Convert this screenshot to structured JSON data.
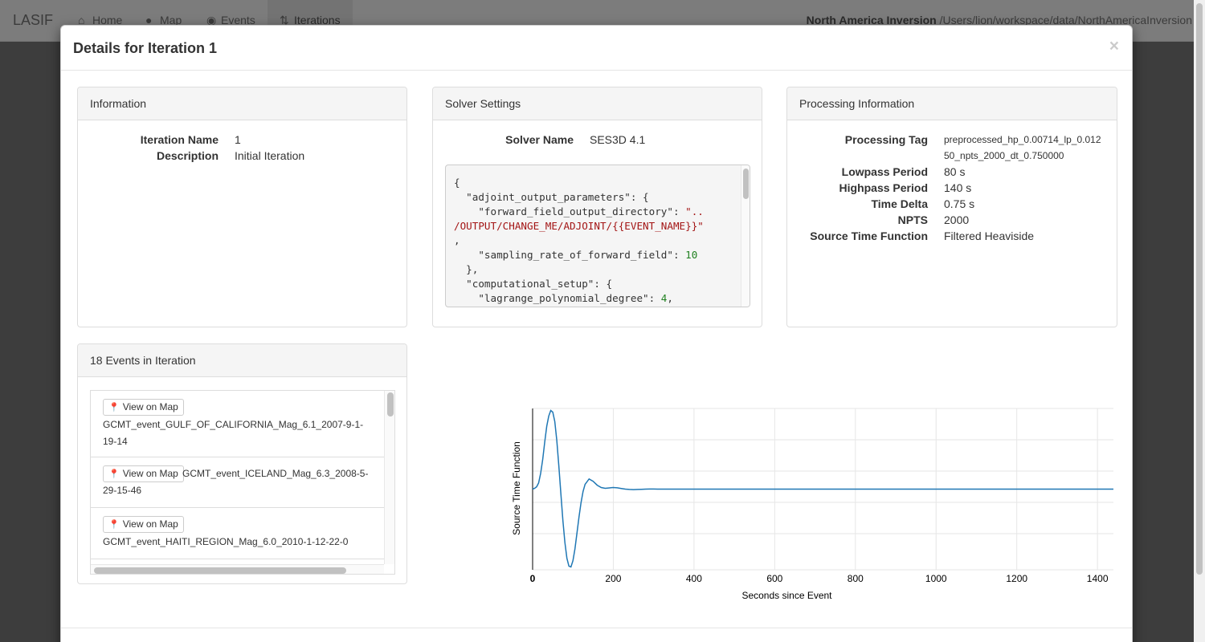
{
  "navbar": {
    "brand": "LASIF",
    "items": [
      {
        "label": "Home",
        "icon": "home-icon"
      },
      {
        "label": "Map",
        "icon": "globe-icon"
      },
      {
        "label": "Events",
        "icon": "record-icon"
      },
      {
        "label": "Iterations",
        "icon": "sort-icon"
      }
    ],
    "project_name": "North America Inversion",
    "project_path": "/Users/lion/workspace/data/NorthAmericaInversion"
  },
  "modal": {
    "title": "Details for Iteration 1",
    "close": "×"
  },
  "information": {
    "heading": "Information",
    "rows": [
      {
        "label": "Iteration Name",
        "value": "1"
      },
      {
        "label": "Description",
        "value": "Initial Iteration"
      }
    ]
  },
  "solver": {
    "heading": "Solver Settings",
    "name_label": "Solver Name",
    "name_value": "SES3D 4.1",
    "code_lines": [
      [
        {
          "t": "p",
          "v": "{"
        }
      ],
      [
        {
          "t": "p",
          "v": "  \"adjoint_output_parameters\": {"
        }
      ],
      [
        {
          "t": "p",
          "v": "    \"forward_field_output_directory\": "
        },
        {
          "t": "s",
          "v": "\".."
        }
      ],
      [
        {
          "t": "s",
          "v": "/OUTPUT/CHANGE_ME/ADJOINT/{{EVENT_NAME}}\""
        }
      ],
      [
        {
          "t": "p",
          "v": ","
        }
      ],
      [
        {
          "t": "p",
          "v": "    \"sampling_rate_of_forward_field\": "
        },
        {
          "t": "n",
          "v": "10"
        }
      ],
      [
        {
          "t": "p",
          "v": "  },"
        }
      ],
      [
        {
          "t": "p",
          "v": "  \"computational_setup\": {"
        }
      ],
      [
        {
          "t": "p",
          "v": "    \"lagrange_polynomial_degree\": "
        },
        {
          "t": "n",
          "v": "4"
        },
        {
          "t": "p",
          "v": ","
        }
      ]
    ]
  },
  "processing": {
    "heading": "Processing Information",
    "tag_label": "Processing Tag",
    "tag_line1": "preprocessed_hp_0.00714_lp_0.012",
    "tag_line2": "50_npts_2000_dt_0.750000",
    "rows": [
      {
        "label": "Lowpass Period",
        "value": "80 s"
      },
      {
        "label": "Highpass Period",
        "value": "140 s"
      },
      {
        "label": "Time Delta",
        "value": "0.75 s"
      },
      {
        "label": "NPTS",
        "value": "2000"
      },
      {
        "label": "Source Time Function",
        "value": "Filtered Heaviside"
      }
    ]
  },
  "events": {
    "heading": "18 Events in Iteration",
    "button_label": "View on Map",
    "items": [
      {
        "line1": "",
        "line2": "GCMT_event_GULF_OF_CALIFORNIA_Mag_6.1_2007-9-1-",
        "line3": "19-14"
      },
      {
        "line1": "GCMT_event_ICELAND_Mag_6.3_2008-5-",
        "line2": "29-15-46",
        "line3": ""
      },
      {
        "line1": "",
        "line2": "GCMT_event_HAITI_REGION_Mag_6.0_2010-1-12-22-0",
        "line3": ""
      }
    ]
  },
  "chart_data": {
    "type": "line",
    "title": "",
    "xlabel": "Seconds since Event",
    "ylabel": "Source Time Function",
    "xlim": [
      0,
      1499.25
    ],
    "ylim": [
      -1.0,
      1.0
    ],
    "x_ticks": [
      "0",
      "200",
      "400",
      "600",
      "800",
      "1000",
      "1200",
      "1400",
      "1499.25"
    ],
    "grid": true,
    "color": "#1f77b4",
    "series": [
      {
        "x": [
          0,
          5,
          10,
          15,
          20,
          25,
          30,
          35,
          40,
          45,
          50,
          55,
          60,
          65,
          70,
          75,
          80,
          85,
          90,
          95,
          100,
          105,
          110,
          115,
          120,
          125,
          130,
          140,
          150,
          160,
          170,
          180,
          190,
          200,
          210,
          220,
          230,
          240,
          250,
          260,
          270,
          280,
          290,
          300,
          310,
          320,
          330,
          400,
          600,
          800,
          1000,
          1200,
          1400,
          1499.25
        ],
        "y": [
          0.0,
          0.01,
          0.03,
          0.08,
          0.2,
          0.38,
          0.6,
          0.8,
          0.93,
          1.0,
          0.98,
          0.86,
          0.62,
          0.3,
          -0.06,
          -0.4,
          -0.68,
          -0.88,
          -0.98,
          -0.99,
          -0.91,
          -0.76,
          -0.56,
          -0.35,
          -0.17,
          -0.03,
          0.06,
          0.13,
          0.1,
          0.05,
          0.02,
          0.01,
          0.015,
          0.02,
          0.016,
          0.008,
          0.0,
          -0.004,
          -0.006,
          -0.004,
          -0.002,
          0.0,
          0.001,
          0.001,
          0.0,
          0.0,
          0.0,
          0.0,
          0.0,
          0.0,
          0.0,
          0.0,
          0.0,
          0.0
        ]
      }
    ]
  }
}
